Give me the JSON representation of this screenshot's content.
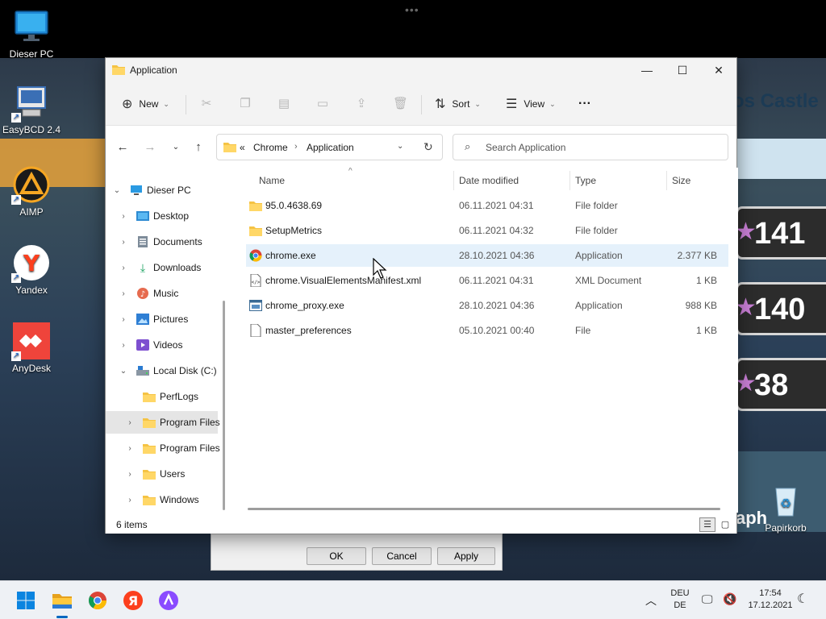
{
  "desktop": {
    "icons": [
      {
        "label": "Dieser PC"
      },
      {
        "label": "EasyBCD 2.4"
      },
      {
        "label": "AIMP"
      },
      {
        "label": "Yandex"
      },
      {
        "label": "AnyDesk"
      },
      {
        "label": "Papirkorb"
      }
    ],
    "wallpaper": {
      "banner_text": "os Castle",
      "scores": [
        "141",
        "140",
        "38"
      ],
      "graph_text": "aph"
    }
  },
  "background_dialog": {
    "ok_label": "OK",
    "cancel_label": "Cancel",
    "apply_label": "Apply"
  },
  "explorer": {
    "title": "Application",
    "window_controls": {
      "minimize": "—",
      "maximize": "☐",
      "close": "✕"
    },
    "commands": {
      "new_label": "New",
      "sort_label": "Sort",
      "view_label": "View",
      "more_label": "···"
    },
    "address": {
      "overflow": "«",
      "crumbs": [
        "Chrome",
        "Application"
      ]
    },
    "search": {
      "placeholder": "Search Application"
    },
    "nav_tree": [
      {
        "label": "Dieser PC",
        "expanded": true,
        "icon": "monitor-icon"
      },
      {
        "label": "Desktop",
        "icon": "desktop-folder-icon"
      },
      {
        "label": "Documents",
        "icon": "documents-icon"
      },
      {
        "label": "Downloads",
        "icon": "download-icon"
      },
      {
        "label": "Music",
        "icon": "music-icon"
      },
      {
        "label": "Pictures",
        "icon": "pictures-icon"
      },
      {
        "label": "Videos",
        "icon": "videos-icon"
      },
      {
        "label": "Local Disk (C:)",
        "expanded": true,
        "icon": "drive-icon"
      },
      {
        "label": "PerfLogs",
        "icon": "folder-icon"
      },
      {
        "label": "Program Files",
        "selected": true,
        "icon": "folder-icon"
      },
      {
        "label": "Program Files",
        "icon": "folder-icon"
      },
      {
        "label": "Users",
        "icon": "folder-icon"
      },
      {
        "label": "Windows",
        "icon": "folder-icon"
      }
    ],
    "columns": {
      "name": "Name",
      "date": "Date modified",
      "type": "Type",
      "size": "Size"
    },
    "files": [
      {
        "name": "95.0.4638.69",
        "date": "06.11.2021 04:31",
        "type": "File folder",
        "size": "",
        "icon": "folder-icon"
      },
      {
        "name": "SetupMetrics",
        "date": "06.11.2021 04:32",
        "type": "File folder",
        "size": "",
        "icon": "folder-icon"
      },
      {
        "name": "chrome.exe",
        "date": "28.10.2021 04:36",
        "type": "Application",
        "size": "2.377 KB",
        "icon": "chrome-icon"
      },
      {
        "name": "chrome.VisualElementsManifest.xml",
        "date": "06.11.2021 04:31",
        "type": "XML Document",
        "size": "1 KB",
        "icon": "xml-file-icon"
      },
      {
        "name": "chrome_proxy.exe",
        "date": "28.10.2021 04:36",
        "type": "Application",
        "size": "988 KB",
        "icon": "exe-file-icon"
      },
      {
        "name": "master_preferences",
        "date": "05.10.2021 00:40",
        "type": "File",
        "size": "1 KB",
        "icon": "file-icon"
      }
    ],
    "status": {
      "items_count": "6 items"
    }
  },
  "taskbar": {
    "language": {
      "line1": "DEU",
      "line2": "DE"
    },
    "clock": {
      "time": "17:54",
      "date": "17.12.2021"
    }
  },
  "colors": {
    "accent": "#0067c0",
    "folder": "#f5c344",
    "hover_row": "#e5f1fb",
    "selected_nav": "#e5e5e5"
  }
}
